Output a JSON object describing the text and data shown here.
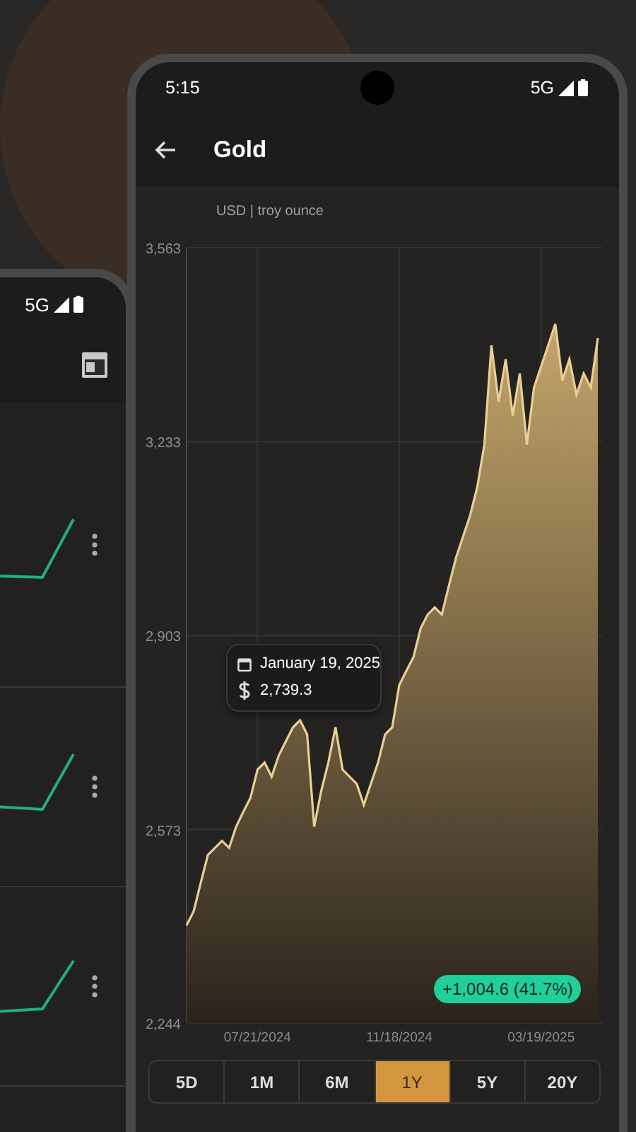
{
  "back_phone": {
    "status_bar": {
      "network": "5G"
    }
  },
  "front_phone": {
    "status_bar": {
      "time": "5:15",
      "network": "5G"
    },
    "app_bar": {
      "title": "Gold"
    },
    "unit_label": "USD | troy ounce",
    "chart": {
      "chart_data": {
        "type": "area",
        "grid": true,
        "categories": [
          null,
          null,
          null,
          null,
          null,
          null,
          null,
          null,
          null,
          null,
          "07/21/2024",
          null,
          null,
          null,
          null,
          null,
          null,
          null,
          null,
          null,
          null,
          null,
          null,
          null,
          null,
          null,
          null,
          null,
          null,
          null,
          "11/18/2024",
          null,
          null,
          null,
          null,
          null,
          null,
          null,
          null,
          null,
          null,
          null,
          null,
          null,
          null,
          null,
          null,
          null,
          null,
          null,
          "03/19/2025",
          null,
          null,
          null,
          null,
          null,
          null,
          null,
          null
        ],
        "yticks": [
          {
            "value": 2244,
            "label": "2,244"
          },
          {
            "value": 2573,
            "label": "2,573"
          },
          {
            "value": 2903,
            "label": "2,903"
          },
          {
            "value": 3233,
            "label": "3,233"
          },
          {
            "value": 3563,
            "label": "3,563"
          }
        ],
        "ylim": [
          2244,
          3563
        ],
        "series": [
          {
            "color": "#e8cf94",
            "values": [
              2410,
              2434,
              2482,
              2530,
              2542,
              2554,
              2542,
              2578,
              2603,
              2627,
              2675,
              2687,
              2663,
              2699,
              2723,
              2747,
              2759,
              2735,
              2578,
              2639,
              2687,
              2747,
              2675,
              2663,
              2651,
              2615,
              2651,
              2687,
              2735,
              2747,
              2819,
              2843,
              2867,
              2915,
              2939,
              2951,
              2939,
              2988,
              3036,
              3072,
              3108,
              3156,
              3228,
              3397,
              3301,
              3373,
              3277,
              3349,
              3228,
              3325,
              3361,
              3397,
              3433,
              3337,
              3373,
              3313,
              3349,
              3325,
              3409
            ]
          }
        ]
      },
      "tooltip": {
        "date": "January 19, 2025",
        "value": "2,739.3"
      },
      "change_badge": "+1,004.6 (41.7%)"
    },
    "ranges": [
      {
        "label": "5D",
        "selected": false
      },
      {
        "label": "1M",
        "selected": false
      },
      {
        "label": "6M",
        "selected": false
      },
      {
        "label": "1Y",
        "selected": true
      },
      {
        "label": "5Y",
        "selected": false
      },
      {
        "label": "20Y",
        "selected": false
      }
    ]
  }
}
